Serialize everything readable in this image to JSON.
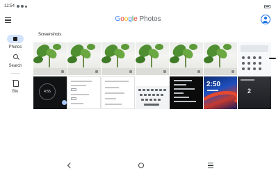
{
  "status_bar": {
    "time": "12:54",
    "indicator_icons": [
      "settings-gear-icon",
      "shield-icon",
      "notification-dot-icon"
    ],
    "battery_icon": "battery-icon"
  },
  "app_bar": {
    "menu_icon": "menu-icon",
    "logo": {
      "google_letters": [
        "G",
        "o",
        "o",
        "g",
        "l",
        "e"
      ],
      "product": "Photos"
    },
    "account_icon": "account-circle-icon"
  },
  "rail": {
    "items": [
      {
        "label": "Photos",
        "icon": "photos-icon",
        "selected": true
      },
      {
        "label": "Search",
        "icon": "search-icon",
        "selected": false
      },
      {
        "label": "Bin",
        "icon": "bin-icon",
        "selected": false
      }
    ]
  },
  "main": {
    "section_title": "Screenshots",
    "row1": [
      {
        "kind": "plant"
      },
      {
        "kind": "plant"
      },
      {
        "kind": "plant"
      },
      {
        "kind": "plant"
      },
      {
        "kind": "plant"
      },
      {
        "kind": "plant"
      },
      {
        "kind": "calculator"
      }
    ],
    "row2": [
      {
        "kind": "timer",
        "text": "4:55"
      },
      {
        "kind": "settings"
      },
      {
        "kind": "settings"
      },
      {
        "kind": "keyboard"
      },
      {
        "kind": "dark-settings"
      },
      {
        "kind": "lockscreen-wallpaper",
        "text": "2:50"
      },
      {
        "kind": "lockscreen-dark",
        "text": "2"
      }
    ]
  },
  "nav_bar": {
    "back_icon": "back-icon",
    "home_icon": "home-icon",
    "recents_icon": "recents-icon"
  },
  "colors": {
    "accent": "#1a73e8",
    "rail_selected": "#d3e3fd",
    "google_blue": "#4285f4",
    "google_red": "#ea4335",
    "google_yellow": "#fbbc05",
    "google_green": "#34a853"
  }
}
